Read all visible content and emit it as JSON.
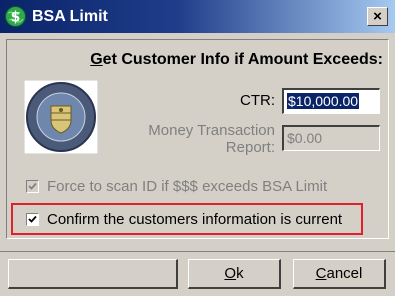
{
  "window": {
    "title": "BSA Limit",
    "close_glyph": "×"
  },
  "heading": {
    "accel": "G",
    "rest": "et Customer Info if Amount Exceeds:"
  },
  "ctr": {
    "label": "CTR:",
    "value": "$10,000.00"
  },
  "mtr": {
    "label_line1": "Money Transaction",
    "label_line2": "Report:",
    "value": "$0.00"
  },
  "force_scan": {
    "label": "Force to scan ID if $$$ exceeds BSA Limit",
    "checked": true,
    "enabled": false
  },
  "confirm": {
    "label": "Confirm the customers information is current",
    "checked": true
  },
  "buttons": {
    "ok_accel": "O",
    "ok_rest": "k",
    "cancel_accel": "C",
    "cancel_rest": "ancel"
  },
  "icons": {
    "app": "dollar-globe-icon",
    "seal": "financial-crimes-enforcement-network-seal"
  },
  "colors": {
    "title_start": "#0a246a",
    "title_end": "#a6caf0",
    "highlight": "#e0202a",
    "face": "#d4d0c8"
  }
}
